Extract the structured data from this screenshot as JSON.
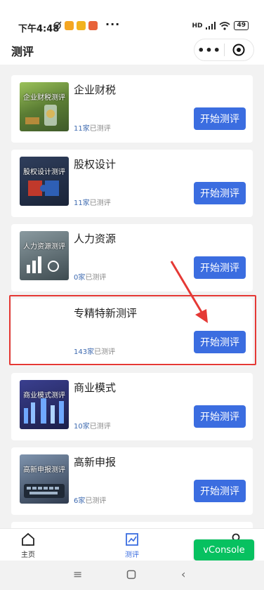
{
  "status": {
    "time": "下午4:48",
    "network": "HD",
    "battery": "49"
  },
  "nav": {
    "title": "测评",
    "more_icon": "more-dots-icon",
    "target_icon": "target-icon"
  },
  "cards": [
    {
      "name": "企业财税",
      "thumb_label": "企业财税测评",
      "count": "11家",
      "count_suffix": "已测评",
      "button": "开始测评",
      "thumb_color": "#6a8f3e"
    },
    {
      "name": "股权设计",
      "thumb_label": "股权设计测评",
      "count": "11家",
      "count_suffix": "已测评",
      "button": "开始测评",
      "thumb_color": "#3a4a6a"
    },
    {
      "name": "人力资源",
      "thumb_label": "人力资源测评",
      "count": "0家",
      "count_suffix": "已测评",
      "button": "开始测评",
      "thumb_color": "#5c6b70"
    },
    {
      "name": "专精特新测评",
      "thumb_label": "",
      "count": "143家",
      "count_suffix": "已测评",
      "button": "开始测评",
      "thumb_color": "#ffffff"
    },
    {
      "name": "商业模式",
      "thumb_label": "商业模式测评",
      "count": "10家",
      "count_suffix": "已测评",
      "button": "开始测评",
      "thumb_color": "#3b3f7a"
    },
    {
      "name": "高新申报",
      "thumb_label": "高新申报测评",
      "count": "6家",
      "count_suffix": "已测评",
      "button": "开始测评",
      "thumb_color": "#506a8a"
    }
  ],
  "tabs": [
    {
      "label": "主页",
      "icon": "home-icon"
    },
    {
      "label": "测评",
      "icon": "edit-chart-icon"
    },
    {
      "label": "",
      "icon": "user-icon"
    }
  ],
  "vconsole": "vConsole",
  "colors": {
    "accent": "#3b6de0",
    "highlight": "#e53935",
    "vconsole": "#07c160"
  }
}
